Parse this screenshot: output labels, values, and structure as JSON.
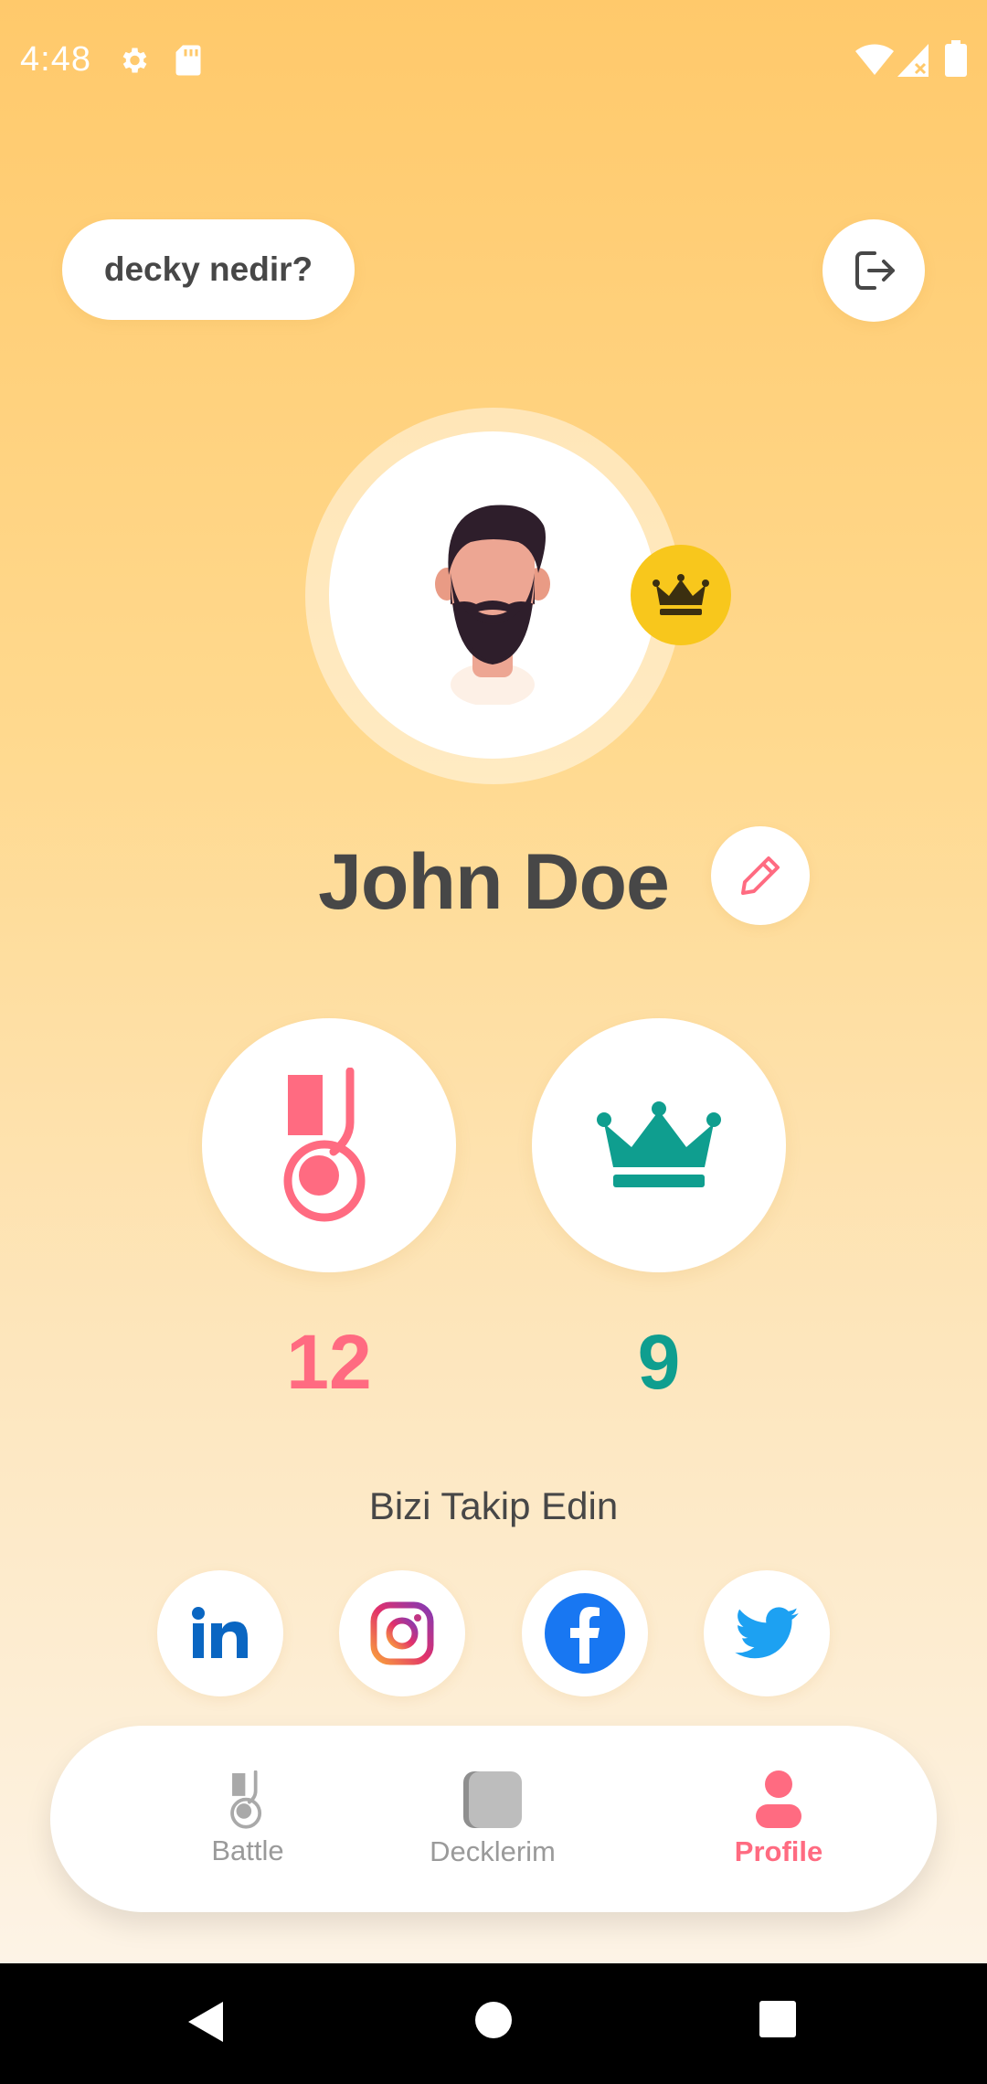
{
  "status_bar": {
    "time": "4:48",
    "icons_left": [
      "gear-icon",
      "sd-card-icon"
    ],
    "icons_right": [
      "wifi-icon",
      "cell-signal-icon",
      "battery-icon"
    ]
  },
  "header": {
    "what_button_label": "decky nedir?",
    "logout_icon": "logout-icon"
  },
  "profile": {
    "name": "John Doe",
    "avatar_icon": "bearded-man-avatar",
    "badge_icon": "crown-icon",
    "edit_icon": "pencil-icon"
  },
  "stats": {
    "battles": {
      "icon": "medal-icon",
      "value": "12",
      "color": "#ff6b81"
    },
    "wins": {
      "icon": "crown-icon",
      "value": "9",
      "color": "#0f9e8f"
    }
  },
  "follow": {
    "title": "Bizi Takip Edin",
    "networks": [
      {
        "name": "linkedin",
        "icon": "linkedin-icon"
      },
      {
        "name": "instagram",
        "icon": "instagram-icon"
      },
      {
        "name": "facebook",
        "icon": "facebook-icon"
      },
      {
        "name": "twitter",
        "icon": "twitter-icon"
      }
    ]
  },
  "bottom_nav": {
    "items": [
      {
        "label": "Battle",
        "icon": "medal-icon",
        "active": false
      },
      {
        "label": "Decklerim",
        "icon": "cards-icon",
        "active": false
      },
      {
        "label": "Profile",
        "icon": "user-icon",
        "active": true
      }
    ]
  },
  "colors": {
    "accent_pink": "#ff6b81",
    "accent_teal": "#0f9e8f",
    "gold": "#f8c71c",
    "background_top": "#ffc96b",
    "background_bottom": "#fdf6ee"
  }
}
